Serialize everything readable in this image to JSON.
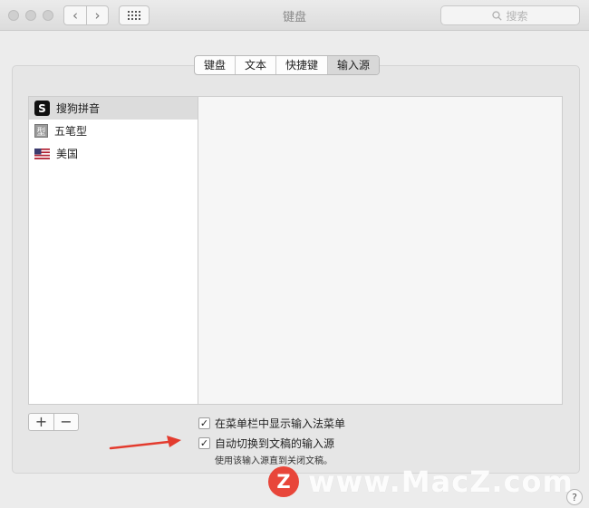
{
  "window": {
    "title": "键盘",
    "search_placeholder": "搜索"
  },
  "toolbar": {
    "back_glyph": "‹",
    "forward_glyph": "›"
  },
  "tabs": [
    {
      "label": "键盘",
      "active": false
    },
    {
      "label": "文本",
      "active": false
    },
    {
      "label": "快捷键",
      "active": false
    },
    {
      "label": "输入源",
      "active": true
    }
  ],
  "input_sources": [
    {
      "label": "搜狗拼音",
      "icon": "sogou-icon",
      "icon_glyph": "S",
      "selected": true
    },
    {
      "label": "五笔型",
      "icon": "wubi-icon",
      "icon_glyph": "型",
      "selected": false
    },
    {
      "label": "美国",
      "icon": "us-flag-icon",
      "selected": false
    }
  ],
  "list_controls": {
    "add": "+",
    "remove": "−"
  },
  "options": {
    "show_in_menu_bar": {
      "label": "在菜单栏中显示输入法菜单",
      "checked": true
    },
    "auto_switch": {
      "label": "自动切换到文稿的输入源",
      "checked": true
    },
    "auto_switch_hint": "使用该输入源直到关闭文稿。",
    "check_glyph": "✓"
  },
  "watermark": {
    "logo_letter": "Z",
    "text": "www.MacZ.com"
  },
  "help": "?",
  "colors": {
    "annotation_arrow": "#e33b2e",
    "watermark_logo": "#e8463a"
  }
}
